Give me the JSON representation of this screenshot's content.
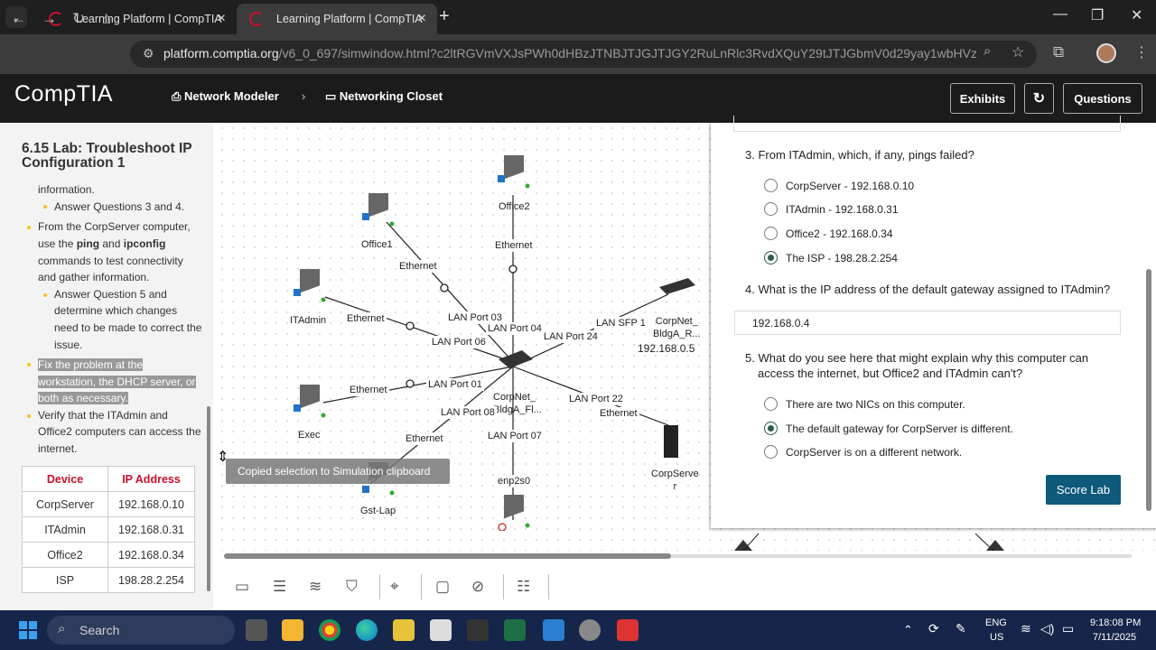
{
  "browser": {
    "tabs": [
      {
        "title": "Learning Platform | CompTIA",
        "active": false
      },
      {
        "title": "Learning Platform | CompTIA",
        "active": true
      }
    ],
    "url_host": "platform.comptia.org",
    "url_path": "/v6_0_697/simwindow.html?c2ltRGVmVXJsPWh0dHBzJTNBJTJGJTJGY2RuLnRlc3RvdXQuY29tJTJGbmV0d29yay1wbHVzLW4xMC0wMD..."
  },
  "app": {
    "logo": "CompTIA",
    "breadcrumb": [
      "Network Modeler",
      "Networking Closet"
    ],
    "buttons": {
      "exhibits": "Exhibits",
      "questions": "Questions"
    }
  },
  "lab": {
    "title": "6.15 Lab: Troubleshoot IP Configuration 1",
    "lines": {
      "l0": "information.",
      "l1": "Answer Questions 3 and 4.",
      "l2a": "From the CorpServer computer,",
      "l2b_pre": "use the ",
      "l2b_ping": "ping",
      "l2b_and": " and ",
      "l2b_ipconfig": "ipconfig",
      "l2c": "commands to test connectivity",
      "l2d": "and gather information.",
      "l3a": "Answer Question 5 and",
      "l3b": "determine which changes",
      "l3c": "need to be made to correct the",
      "l3d": "issue.",
      "l4a": "Fix the problem at the",
      "l4b": "workstation, the DHCP server, or",
      "l4c": "both as necessary.",
      "l5a": "Verify that the ITAdmin and",
      "l5b": "Office2 computers can access the",
      "l5c": "internet."
    },
    "table": {
      "headers": [
        "Device",
        "IP Address"
      ],
      "rows": [
        [
          "CorpServer",
          "192.168.0.10"
        ],
        [
          "ITAdmin",
          "192.168.0.31"
        ],
        [
          "Office2",
          "192.168.0.34"
        ],
        [
          "ISP",
          "198.28.2.254"
        ]
      ]
    }
  },
  "canvas": {
    "devices": {
      "office1": "Office1",
      "office2": "Office2",
      "itadmin": "ITAdmin",
      "exec": "Exec",
      "gstlap": "Gst-Lap",
      "corpserver": "CorpServe\nr",
      "switch": "CorpNet_\nBldgA_Fl...",
      "router": "CorpNet_\nBldgA_R...",
      "router_ip": "192.168.0.5"
    },
    "labels": {
      "eth_office1": "Ethernet",
      "eth_office2": "Ethernet",
      "eth_itadmin": "Ethernet",
      "eth_exec": "Ethernet",
      "eth_gst": "Ethernet",
      "eth_corpserver": "Ethernet",
      "p03": "LAN Port 03",
      "p04": "LAN Port 04",
      "p06": "LAN Port 06",
      "p24": "LAN Port 24",
      "p01": "LAN Port 01",
      "p08": "LAN Port 08",
      "p07": "LAN Port 07",
      "p22": "LAN Port 22",
      "sfp1": "LAN SFP 1",
      "enp2s0": "enp2s0"
    },
    "toast": "Copied selection to Simulation clipboard"
  },
  "questions": {
    "q3": "3. From ITAdmin, which, if any, pings failed?",
    "q3_options": [
      {
        "label": "CorpServer - 192.168.0.10",
        "selected": false
      },
      {
        "label": "ITAdmin - 192.168.0.31",
        "selected": false
      },
      {
        "label": "Office2 - 192.168.0.34",
        "selected": false
      },
      {
        "label": "The ISP - 198.28.2.254",
        "selected": true
      }
    ],
    "q4": "4. What is the IP address of the default gateway assigned to ITAdmin?",
    "q4_answer": "192.168.0.4",
    "q5a": "5. What do you see here that might explain why this computer can",
    "q5b": "access the internet, but Office2 and ITAdmin can't?",
    "q5_options": [
      {
        "label": "There are two NICs on this computer.",
        "selected": false
      },
      {
        "label": "The default gateway for CorpServer is different.",
        "selected": true
      },
      {
        "label": "CorpServer is on a different network.",
        "selected": false
      }
    ],
    "score_button": "Score Lab"
  },
  "taskbar": {
    "search": "Search",
    "lang1": "ENG",
    "lang2": "US",
    "time": "9:18:08 PM",
    "date": "7/11/2025"
  },
  "colors": {
    "accent": "#c8102e",
    "header": "#1b1b1b",
    "score": "#0e5a7a",
    "radio": "#2d5c4e"
  }
}
